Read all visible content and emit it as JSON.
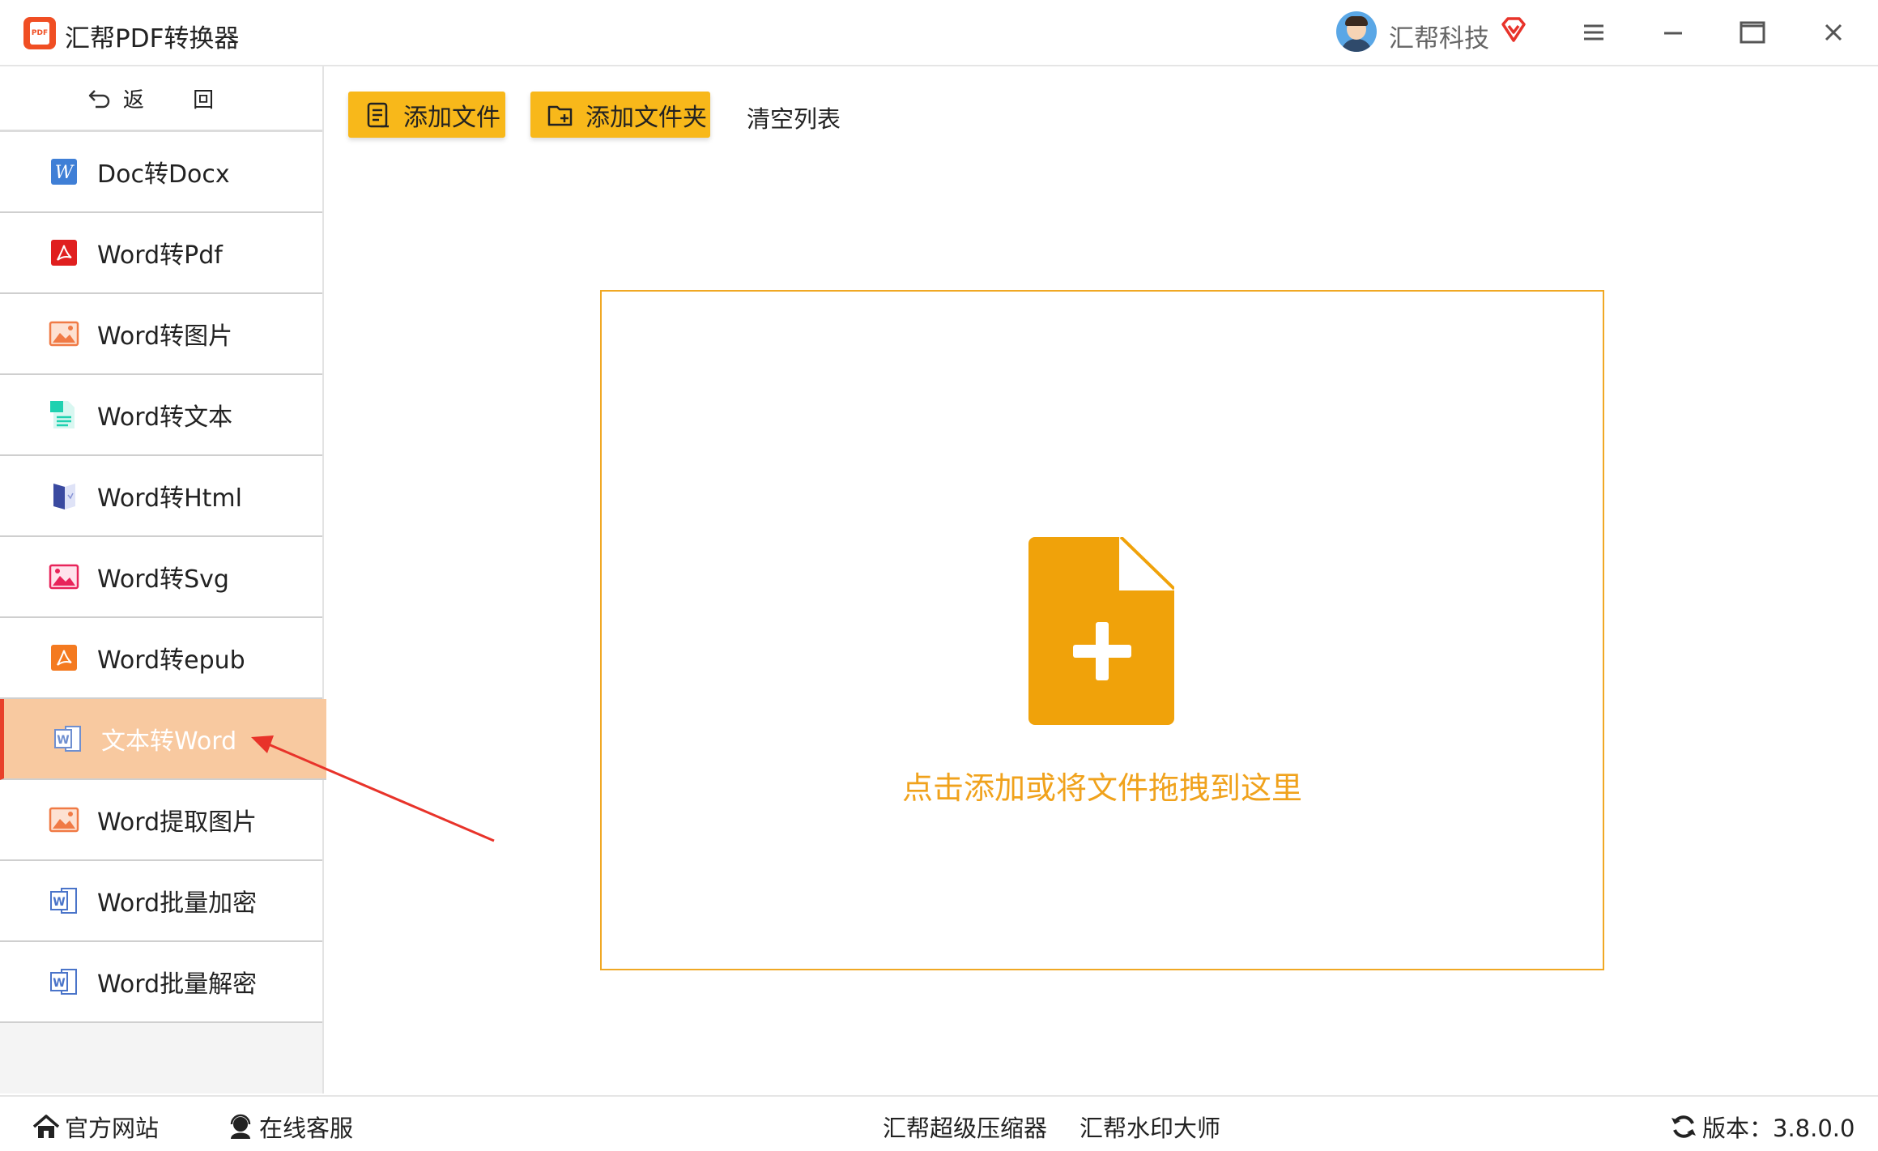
{
  "window": {
    "title": "汇帮PDF转换器",
    "logo_text": "PDF",
    "user_name": "汇帮科技",
    "icons": [
      "menu-icon",
      "minimize-icon",
      "maximize-icon",
      "close-icon"
    ]
  },
  "sidebar": {
    "back_label": "返 回",
    "items": [
      {
        "label": "Doc转Docx",
        "icon": "word-w-icon"
      },
      {
        "label": "Word转Pdf",
        "icon": "pdf-icon"
      },
      {
        "label": "Word转图片",
        "icon": "image-icon"
      },
      {
        "label": "Word转文本",
        "icon": "text-doc-icon"
      },
      {
        "label": "Word转Html",
        "icon": "html-book-icon"
      },
      {
        "label": "Word转Svg",
        "icon": "svg-image-icon"
      },
      {
        "label": "Word转epub",
        "icon": "epub-icon"
      },
      {
        "label": "文本转Word",
        "icon": "word-doc-icon",
        "active": true
      },
      {
        "label": "Word提取图片",
        "icon": "image-icon"
      },
      {
        "label": "Word批量加密",
        "icon": "word-doc-icon"
      },
      {
        "label": "Word批量解密",
        "icon": "word-doc-icon"
      }
    ]
  },
  "toolbar": {
    "add_file": "添加文件",
    "add_folder": "添加文件夹",
    "clear_list": "清空列表"
  },
  "dropzone": {
    "hint": "点击添加或将文件拖拽到这里"
  },
  "footer": {
    "website": "官方网站",
    "support": "在线客服",
    "compressor": "汇帮超级压缩器",
    "watermark": "汇帮水印大师",
    "version": "版本：3.8.0.0"
  },
  "colors": {
    "accent": "#f8b81a",
    "active_item_bg": "#f8c9a0",
    "active_item_bar": "#e8402a",
    "drop_border": "#f0a824",
    "drop_text": "#f0a21c"
  }
}
